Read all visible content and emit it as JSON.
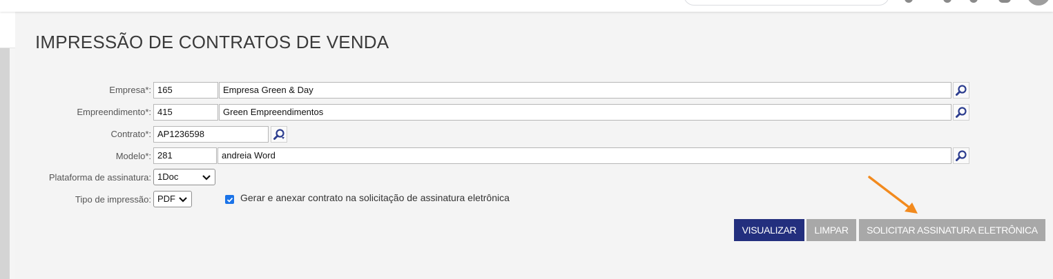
{
  "page": {
    "title": "IMPRESSÃO DE CONTRATOS DE VENDA"
  },
  "form": {
    "empresa": {
      "label": "Empresa*:",
      "code": "165",
      "name": "Empresa Green & Day"
    },
    "empreendimento": {
      "label": "Empreendimento*:",
      "code": "415",
      "name": "Green Empreendimentos"
    },
    "contrato": {
      "label": "Contrato*:",
      "value": "AP1236598"
    },
    "modelo": {
      "label": "Modelo*:",
      "code": "281",
      "name": "andreia Word"
    },
    "plataforma": {
      "label": "Plataforma de assinatura:",
      "selected": "1Doc"
    },
    "tipo_impressao": {
      "label": "Tipo de impressão:",
      "selected": "PDF"
    },
    "gerar_anexar": {
      "label": "Gerar e anexar contrato na solicitação de assinatura eletrônica",
      "checked": true
    }
  },
  "actions": {
    "visualizar": "VISUALIZAR",
    "limpar": "LIMPAR",
    "solicitar": "SOLICITAR ASSINATURA ELETRÔNICA"
  },
  "colors": {
    "primary_button": "#232f7e",
    "disabled_button": "#a8a8a8",
    "annotation_arrow": "#f28a1e",
    "checkbox": "#1a73e8",
    "lookup_icon": "#2c3d8f"
  },
  "icons": {
    "lookup": "magnifier-icon",
    "contract_lookup": "magnifier-refresh-icon",
    "dropdown": "chevron-down-icon",
    "annotation": "arrow-icon"
  }
}
